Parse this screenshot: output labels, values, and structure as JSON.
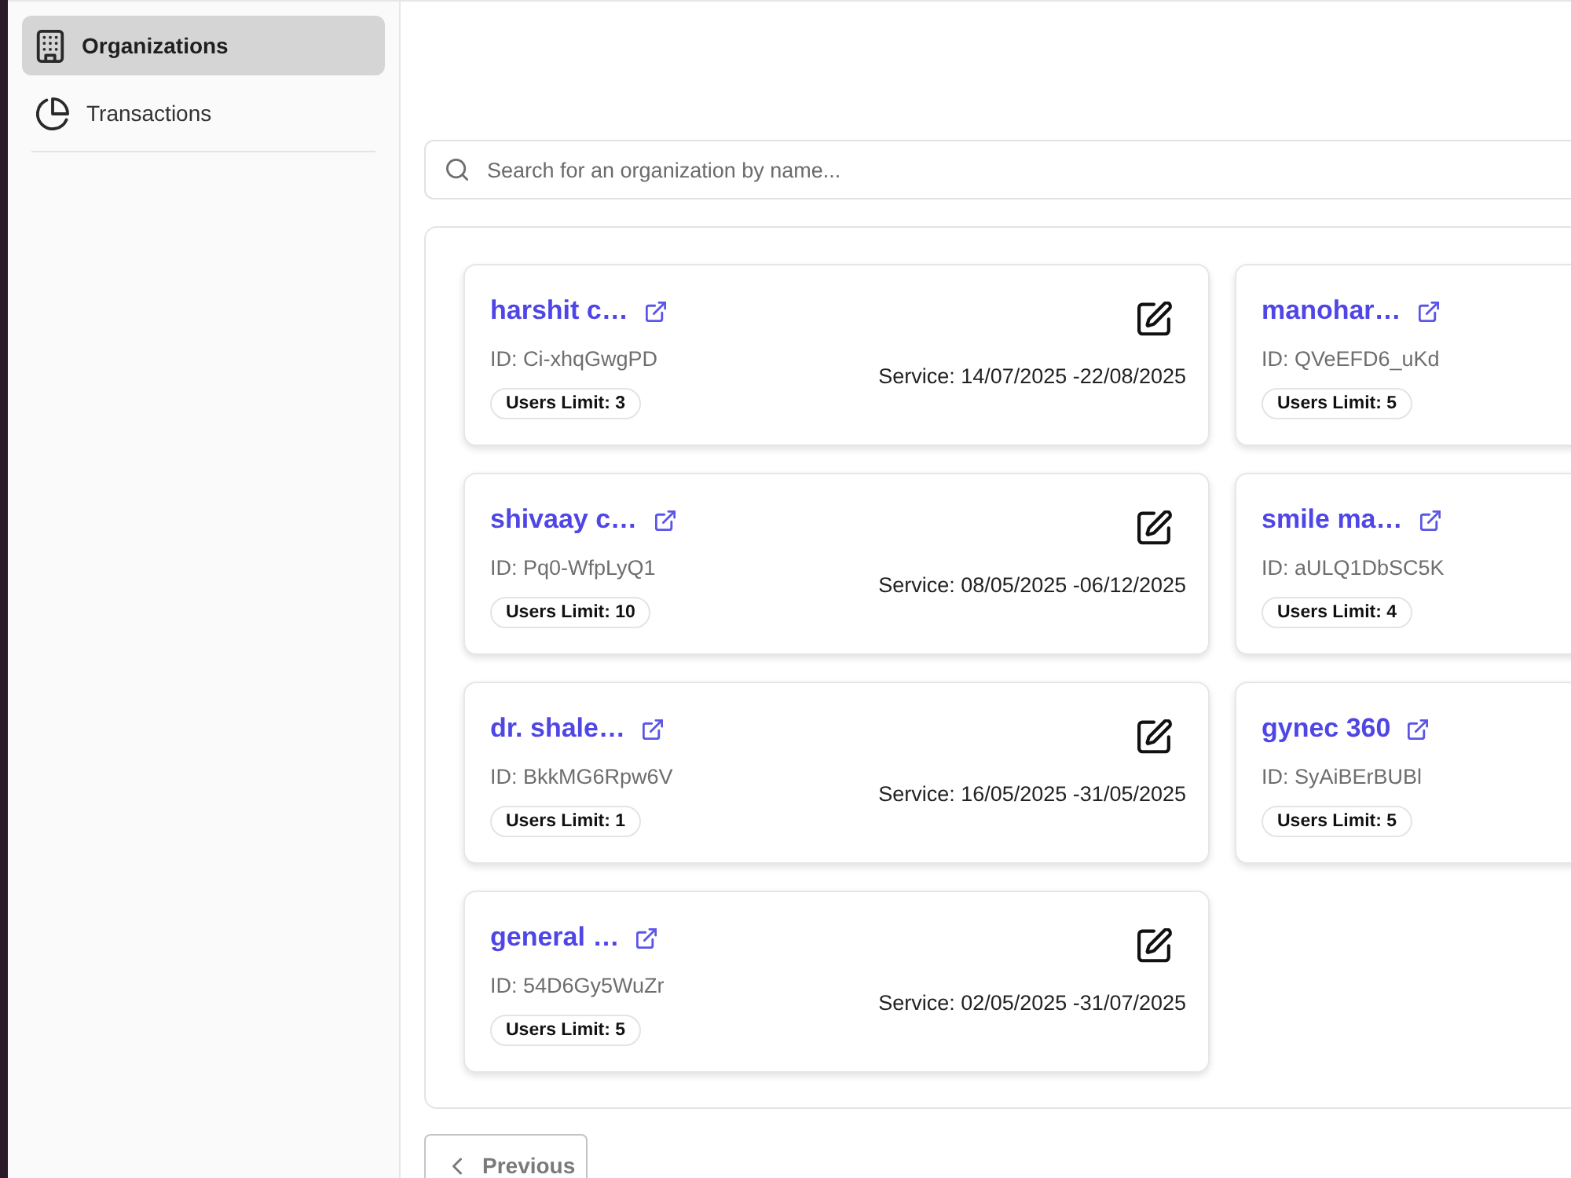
{
  "sidebar": {
    "items": [
      {
        "label": "Organizations",
        "selected": true
      },
      {
        "label": "Transactions",
        "selected": false
      }
    ]
  },
  "search": {
    "placeholder": "Search for an organization by name..."
  },
  "organizations": [
    {
      "name": "harshit c…",
      "id": "ID: Ci-xhqGwgPD",
      "users_limit": "Users Limit: 3",
      "service": "Service: 14/07/2025 -22/08/2025"
    },
    {
      "name": "manohar…",
      "id": "ID: QVeEFD6_uKd",
      "users_limit": "Users Limit: 5"
    },
    {
      "name": "shivaay c…",
      "id": "ID: Pq0-WfpLyQ1",
      "users_limit": "Users Limit: 10",
      "service": "Service: 08/05/2025 -06/12/2025"
    },
    {
      "name": "smile ma…",
      "id": "ID: aULQ1DbSC5K",
      "users_limit": "Users Limit: 4"
    },
    {
      "name": "dr. shale…",
      "id": "ID: BkkMG6Rpw6V",
      "users_limit": "Users Limit: 1",
      "service": "Service: 16/05/2025 -31/05/2025"
    },
    {
      "name": "gynec 360",
      "id": "ID: SyAiBErBUBl",
      "users_limit": "Users Limit: 5"
    },
    {
      "name": "general …",
      "id": "ID: 54D6Gy5WuZr",
      "users_limit": "Users Limit: 5",
      "service": "Service: 02/05/2025 -31/07/2025"
    }
  ],
  "pagination": {
    "previous": "Previous"
  }
}
